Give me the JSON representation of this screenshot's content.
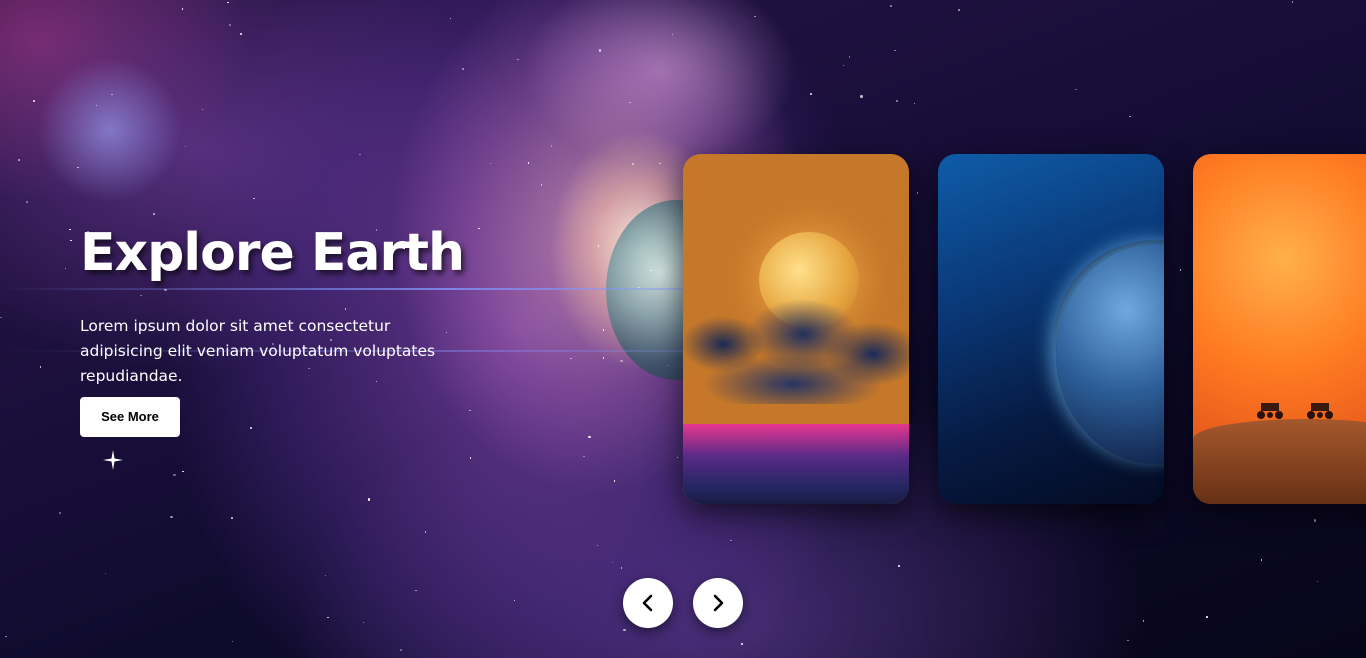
{
  "hero": {
    "title": "Explore Earth",
    "description": "Lorem ipsum dolor sit amet consectetur adipisicing elit veniam voluptatum voluptates repudiandae.",
    "button_label": "See More"
  },
  "slides": [
    {
      "name": "moon-over-ocean"
    },
    {
      "name": "blue-planet"
    },
    {
      "name": "mars-rovers"
    }
  ],
  "controls": {
    "prev_icon": "chevron-left-icon",
    "next_icon": "chevron-right-icon"
  }
}
